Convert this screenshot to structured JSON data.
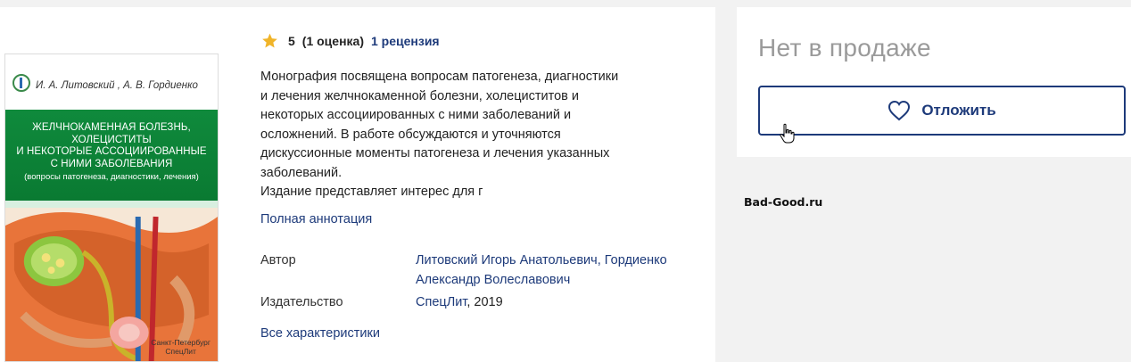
{
  "cover": {
    "authors": "И. А. Литовский , А. В. Гордиенко",
    "title_lines": [
      "Желчнокаменная болезнь,",
      "холециститы",
      "и некоторые ассоциированные",
      "с ними заболевания"
    ],
    "subtitle": "(вопросы патогенеза, диагностики, лечения)",
    "city_line1": "Санкт-Петербург",
    "city_line2": "СпецЛит"
  },
  "rating": {
    "score": "5",
    "count": "(1 оценка)",
    "reviews": "1 рецензия",
    "star_color": "#f0b429"
  },
  "description": {
    "text": "Монография посвящена вопросам патогенеза, диагностики\nи лечения желчнокаменной болезни, холециститов и\nнекоторых ассоциированных с ними заболеваний и\nосложнений. В работе обсуждаются и уточняются\nдискуссионные моменты патогенеза и лечения указанных\nзаболеваний.\nИздание представляет интерес для г",
    "full_link": "Полная аннотация"
  },
  "properties": {
    "author_label": "Автор",
    "author_value": "Литовский Игорь Анатольевич, Гордиенко Александр Волеславович",
    "publisher_label": "Издательство",
    "publisher_name": "СпецЛит",
    "publisher_year": ", 2019",
    "all_link": "Все характеристики"
  },
  "sidebar": {
    "status": "Нет в продаже",
    "save_label": "Отложить"
  },
  "watermark": "Bad-Good.ru",
  "colors": {
    "accent": "#1d3a7a",
    "cover_green": "#0a7a32"
  },
  "icons": [
    "star-icon",
    "heart-icon",
    "hand-cursor-icon",
    "medical-logo-icon"
  ]
}
